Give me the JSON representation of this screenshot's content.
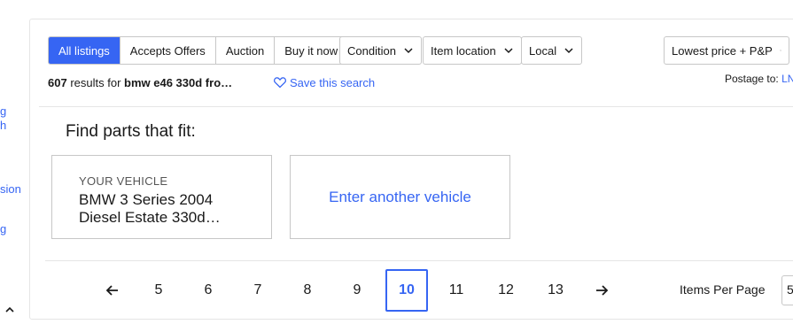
{
  "left_rail": {
    "links": [
      "g",
      "h",
      "sion",
      "g"
    ]
  },
  "filters": {
    "tabs": [
      "All listings",
      "Accepts Offers",
      "Auction",
      "Buy it now"
    ],
    "active_tab": "All listings",
    "dropdowns": [
      "Condition",
      "Item location",
      "Local"
    ],
    "sort": "Lowest price + P&P"
  },
  "results": {
    "count": "607",
    "text": "results for",
    "query": "bmw e46 330d fro…",
    "save_search": "Save this search",
    "postage_label": "Postage to:",
    "postage_location": "LN"
  },
  "fitment": {
    "title": "Find parts that fit:",
    "vehicle_label": "YOUR VEHICLE",
    "vehicle_name": "BMW 3 Series 2004 Diesel Estate 330d…",
    "another": "Enter another vehicle"
  },
  "pagination": {
    "pages": [
      "5",
      "6",
      "7",
      "8",
      "9",
      "10",
      "11",
      "12",
      "13"
    ],
    "current": "10",
    "items_per_page_label": "Items Per Page",
    "items_per_page_value": "5"
  },
  "colors": {
    "accent": "#3665f3",
    "text": "#191919",
    "border": "#c7c7c7"
  },
  "icons": [
    "heart-icon",
    "chevron-down-icon",
    "arrow-left-icon",
    "arrow-right-icon",
    "chevron-up-icon"
  ]
}
